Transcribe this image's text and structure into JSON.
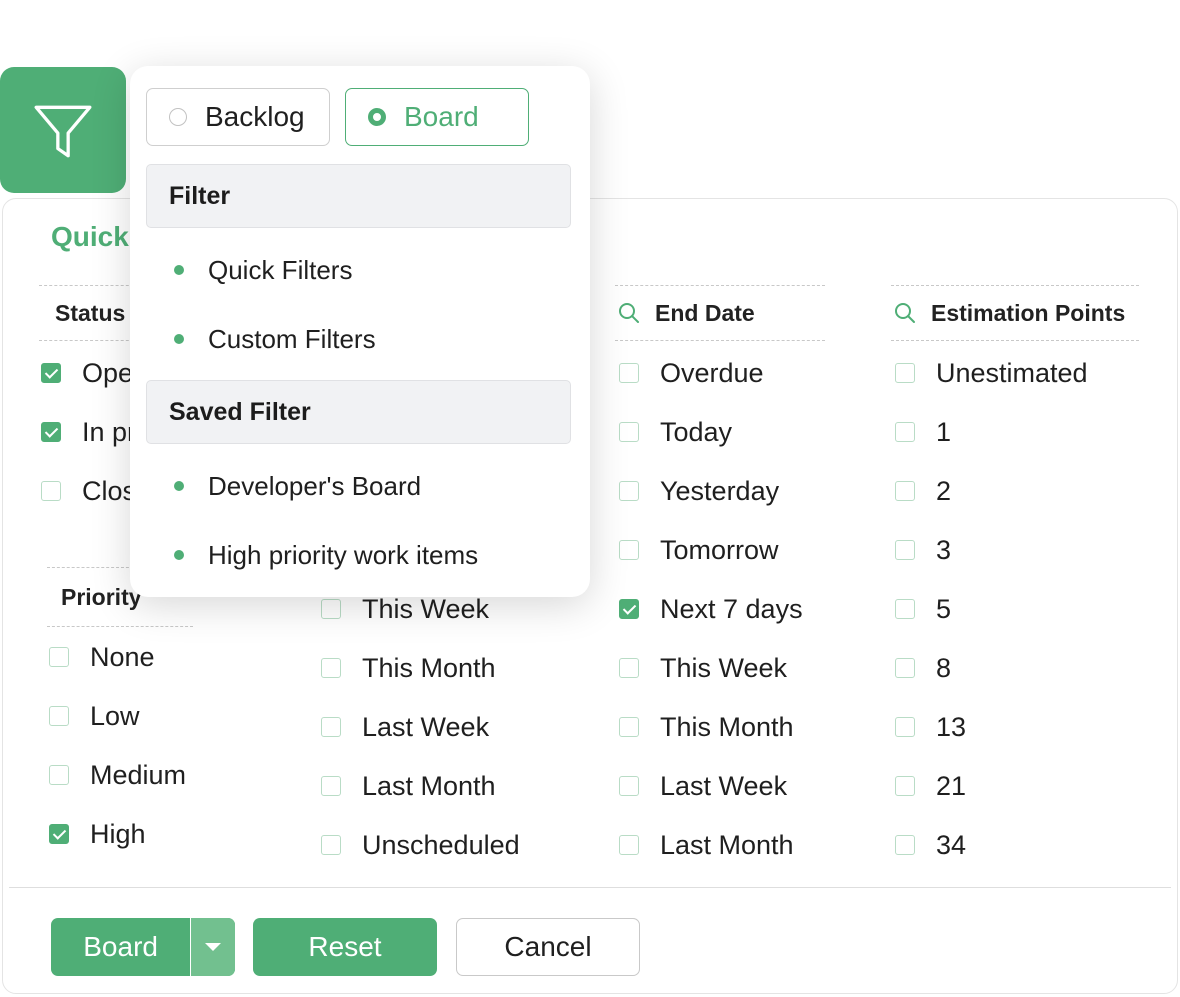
{
  "panel": {
    "title": "Quick Filters",
    "columns": {
      "status": {
        "header": "Status",
        "options": [
          {
            "label": "Open",
            "checked": true
          },
          {
            "label": "In progress",
            "checked": true
          },
          {
            "label": "Closed",
            "checked": false
          }
        ]
      },
      "priority": {
        "header": "Priority",
        "options": [
          {
            "label": "None",
            "checked": false
          },
          {
            "label": "Low",
            "checked": false
          },
          {
            "label": "Medium",
            "checked": false
          },
          {
            "label": "High",
            "checked": true
          }
        ]
      },
      "start_date": {
        "options": [
          {
            "label": "This Week",
            "checked": false
          },
          {
            "label": "This Month",
            "checked": false
          },
          {
            "label": "Last Week",
            "checked": false
          },
          {
            "label": "Last Month",
            "checked": false
          },
          {
            "label": "Unscheduled",
            "checked": false
          }
        ]
      },
      "end_date": {
        "header": "End Date",
        "options": [
          {
            "label": "Overdue",
            "checked": false
          },
          {
            "label": "Today",
            "checked": false
          },
          {
            "label": "Yesterday",
            "checked": false
          },
          {
            "label": "Tomorrow",
            "checked": false
          },
          {
            "label": "Next 7 days",
            "checked": true
          },
          {
            "label": "This Week",
            "checked": false
          },
          {
            "label": "This Month",
            "checked": false
          },
          {
            "label": "Last Week",
            "checked": false
          },
          {
            "label": "Last Month",
            "checked": false
          }
        ]
      },
      "estimation": {
        "header": "Estimation Points",
        "options": [
          {
            "label": "Unestimated",
            "checked": false
          },
          {
            "label": "1",
            "checked": false
          },
          {
            "label": "2",
            "checked": false
          },
          {
            "label": "3",
            "checked": false
          },
          {
            "label": "5",
            "checked": false
          },
          {
            "label": "8",
            "checked": false
          },
          {
            "label": "13",
            "checked": false
          },
          {
            "label": "21",
            "checked": false
          },
          {
            "label": "34",
            "checked": false
          }
        ]
      }
    },
    "buttons": {
      "board": "Board",
      "reset": "Reset",
      "cancel": "Cancel"
    }
  },
  "popup": {
    "view_toggle": {
      "backlog": "Backlog",
      "board": "Board",
      "selected": "Board"
    },
    "filter_section": "Filter",
    "filter_items": [
      "Quick Filters",
      "Custom Filters"
    ],
    "saved_section": "Saved Filter",
    "saved_items": [
      "Developer's Board",
      "High priority work items"
    ]
  },
  "colors": {
    "accent": "#4fae76",
    "section_bg": "#f1f2f4"
  },
  "icons": {
    "filter": "funnel-icon",
    "search": "search-icon",
    "dropdown": "caret-down-icon"
  }
}
